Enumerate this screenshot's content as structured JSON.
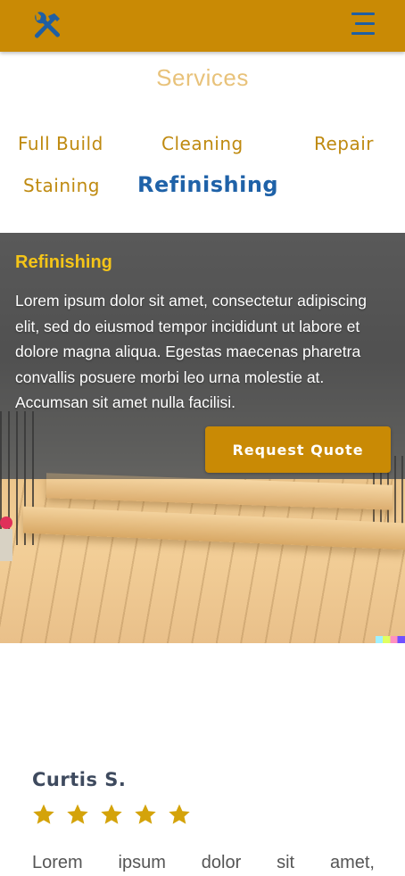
{
  "header": {
    "logo_icon": "tools-icon",
    "menu_icon": "hamburger-menu-icon",
    "bar_color": "#c98a05",
    "icon_color": "#1f5fa3"
  },
  "services": {
    "title": "Services",
    "tabs": [
      {
        "label": "Full Build",
        "active": false
      },
      {
        "label": "Cleaning",
        "active": false
      },
      {
        "label": "Repair",
        "active": false
      },
      {
        "label": "Staining",
        "active": false
      },
      {
        "label": "Refinishing",
        "active": true
      }
    ]
  },
  "panel": {
    "title": "Refinishing",
    "body": "Lorem ipsum dolor sit amet, consectetur adipiscing elit, sed do eiusmod tempor incididunt ut labore et dolore magna aliqua. Egestas maecenas pharetra convallis posuere morbi leo urna molestie at. Accumsan sit amet nulla facilisi.",
    "button_label": "Request Quote",
    "image": "wooden-deck-photo"
  },
  "review": {
    "name": "Curtis S.",
    "rating": 5,
    "star_icon": "star-icon",
    "star_color": "#d4a30a",
    "text": "Lorem ipsum dolor sit amet,"
  }
}
